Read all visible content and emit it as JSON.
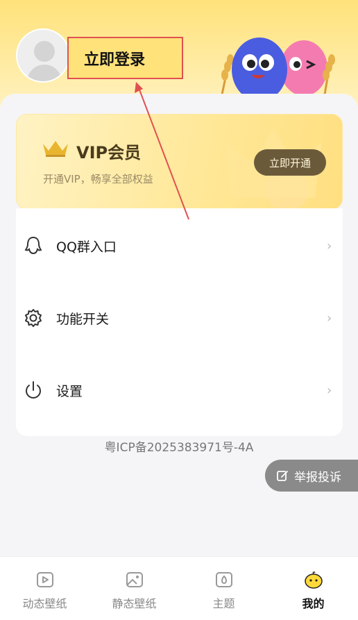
{
  "header": {
    "login_label": "立即登录",
    "avatar_icon": "user-avatar-placeholder"
  },
  "vip": {
    "title": "VIP会员",
    "subtitle": "开通VIP，畅享全部权益",
    "button_label": "立即开通",
    "icon": "crown-icon",
    "accent": "#e9b52f"
  },
  "menu": {
    "items": [
      {
        "label": "QQ群入口",
        "icon": "qq-icon"
      },
      {
        "label": "功能开关",
        "icon": "gear-icon"
      },
      {
        "label": "设置",
        "icon": "power-icon"
      }
    ],
    "arrow": "›"
  },
  "footer": {
    "icp": "粤ICP备2025383971号-4A",
    "report_label": "举报投诉"
  },
  "tabbar": {
    "tabs": [
      {
        "label": "动态壁纸",
        "icon": "video-wallpaper-icon"
      },
      {
        "label": "静态壁纸",
        "icon": "image-wallpaper-icon"
      },
      {
        "label": "主题",
        "icon": "theme-icon"
      },
      {
        "label": "我的",
        "icon": "mascot-profile-icon",
        "active": true
      }
    ]
  },
  "colors": {
    "header_yellow": "#ffe27a",
    "annotation_red": "#e05050",
    "vip_button": "#6b5a3a"
  }
}
